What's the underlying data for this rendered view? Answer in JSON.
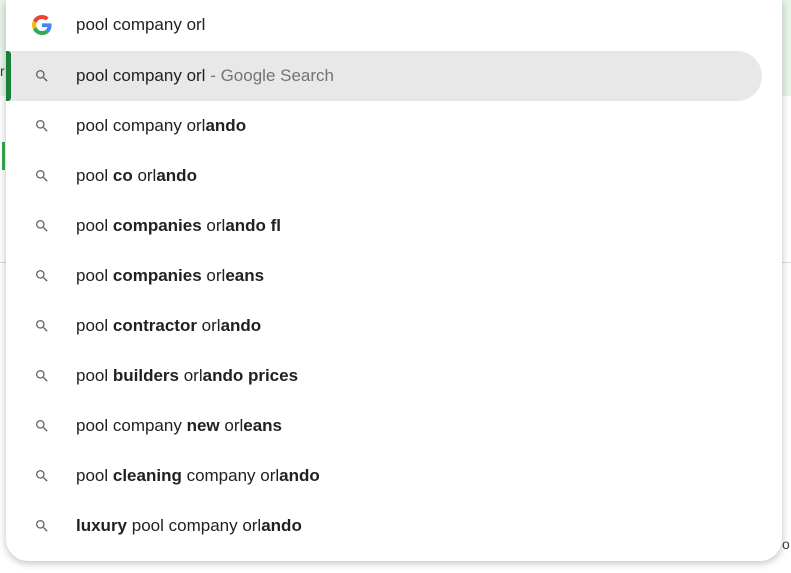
{
  "omnibox": {
    "input_value": "pool company orl",
    "logo_icon": "google-g-icon"
  },
  "selected_suggestion": {
    "text": "pool company orl",
    "separator": " - ",
    "provider": "Google Search",
    "icon": "search-icon",
    "accent_color": "#188038"
  },
  "suggestions": [
    {
      "parts": [
        {
          "t": "pool company orl",
          "b": false
        },
        {
          "t": "ando",
          "b": true
        }
      ]
    },
    {
      "parts": [
        {
          "t": "pool ",
          "b": false
        },
        {
          "t": "co",
          "b": true
        },
        {
          "t": " orl",
          "b": false
        },
        {
          "t": "ando",
          "b": true
        }
      ]
    },
    {
      "parts": [
        {
          "t": "pool ",
          "b": false
        },
        {
          "t": "companies",
          "b": true
        },
        {
          "t": " orl",
          "b": false
        },
        {
          "t": "ando fl",
          "b": true
        }
      ]
    },
    {
      "parts": [
        {
          "t": "pool ",
          "b": false
        },
        {
          "t": "companies",
          "b": true
        },
        {
          "t": " orl",
          "b": false
        },
        {
          "t": "eans",
          "b": true
        }
      ]
    },
    {
      "parts": [
        {
          "t": "pool ",
          "b": false
        },
        {
          "t": "contractor",
          "b": true
        },
        {
          "t": " orl",
          "b": false
        },
        {
          "t": "ando",
          "b": true
        }
      ]
    },
    {
      "parts": [
        {
          "t": "pool ",
          "b": false
        },
        {
          "t": "builders",
          "b": true
        },
        {
          "t": " orl",
          "b": false
        },
        {
          "t": "ando prices",
          "b": true
        }
      ]
    },
    {
      "parts": [
        {
          "t": "pool company ",
          "b": false
        },
        {
          "t": "new",
          "b": true
        },
        {
          "t": " orl",
          "b": false
        },
        {
          "t": "eans",
          "b": true
        }
      ]
    },
    {
      "parts": [
        {
          "t": "pool ",
          "b": false
        },
        {
          "t": "cleaning",
          "b": true
        },
        {
          "t": " company orl",
          "b": false
        },
        {
          "t": "ando",
          "b": true
        }
      ]
    },
    {
      "parts": [
        {
          "t": "luxury",
          "b": true
        },
        {
          "t": " pool company orl",
          "b": false
        },
        {
          "t": "ando",
          "b": true
        }
      ]
    }
  ],
  "background": {
    "left_edge_char": "r",
    "right_edge_char": "o"
  },
  "colors": {
    "selected_bg": "#e8e8e9",
    "text": "#202124",
    "muted": "#70757a",
    "icon": "#5f6368"
  }
}
